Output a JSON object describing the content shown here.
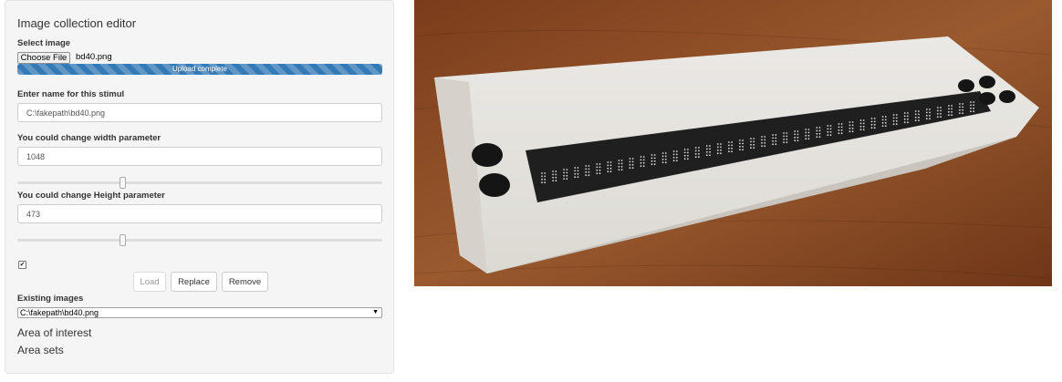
{
  "editor": {
    "title": "Image collection editor",
    "select_image_label": "Select image",
    "choose_file_label": "Choose File",
    "file_name": "bd40.png",
    "progress": {
      "label": "Upload complete",
      "fraction": 1.0
    },
    "name_label": "Enter name for this stimul",
    "name_value": "C:\\fakepath\\bd40.png",
    "width_label": "You could change width parameter",
    "width_value": "1048",
    "width_slider_fraction": 0.29,
    "height_label": "You could change Height parameter",
    "height_value": "473",
    "height_slider_fraction": 0.29,
    "checkbox_checked": true,
    "buttons": {
      "load": "Load",
      "replace": "Replace",
      "remove": "Remove"
    },
    "existing_label": "Existing images",
    "existing_selected": "C:\\fakepath\\bd40.png",
    "area_of_interest": "Area of interest",
    "area_sets": "Area sets"
  },
  "preview": {
    "colors": {
      "wood": "#8a4a23",
      "device_body": "#e4e1dc",
      "braille_strip": "#1f1f1f"
    }
  }
}
